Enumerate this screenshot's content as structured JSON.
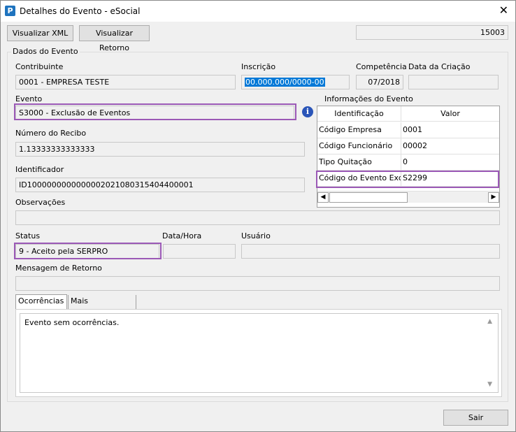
{
  "window": {
    "title": "Detalhes do Evento - eSocial",
    "app_icon": "P",
    "close": "✕"
  },
  "toolbar": {
    "xml_button": "Visualizar XML",
    "retorno_button": "Visualizar Retorno",
    "id_value": "15003"
  },
  "dados": {
    "legend": "Dados do Evento",
    "contribuinte_label": "Contribuinte",
    "contribuinte_value": "0001 - EMPRESA TESTE",
    "inscricao_label": "Inscrição",
    "inscricao_value": "00.000.000/0000-00",
    "competencia_label": "Competência",
    "competencia_value": "07/2018",
    "data_criacao_label": "Data da Criação",
    "data_criacao_value": "",
    "evento_label": "Evento",
    "evento_value": "S3000 - Exclusão de Eventos",
    "recibo_label": "Número do Recibo",
    "recibo_value": "1.13333333333333",
    "identificador_label": "Identificador",
    "identificador_value": "ID1000000000000002021080315404400001",
    "observacoes_label": "Observações",
    "observacoes_value": "",
    "status_label": "Status",
    "status_value": "9 - Aceito pela SERPRO",
    "datahora_label": "Data/Hora",
    "datahora_value": "",
    "usuario_label": "Usuário",
    "usuario_value": "",
    "mensagem_label": "Mensagem de Retorno",
    "mensagem_value": ""
  },
  "info_evento": {
    "title": "Informações do Evento",
    "col_identificacao": "Identificação",
    "col_valor": "Valor",
    "rows": [
      {
        "id": "Código Empresa",
        "valor": "0001"
      },
      {
        "id": "Código Funcionário",
        "valor": "00002"
      },
      {
        "id": "Tipo Quitação",
        "valor": "0"
      },
      {
        "id": "Código do Evento Exclu",
        "valor": "S2299"
      }
    ]
  },
  "tabs": {
    "ocorrencias": "Ocorrências",
    "mais_info": "Mais Informações",
    "content": "Evento sem ocorrências."
  },
  "footer": {
    "sair": "Sair"
  },
  "colors": {
    "highlight": "#9b59b6",
    "selection": "#0078d7"
  }
}
